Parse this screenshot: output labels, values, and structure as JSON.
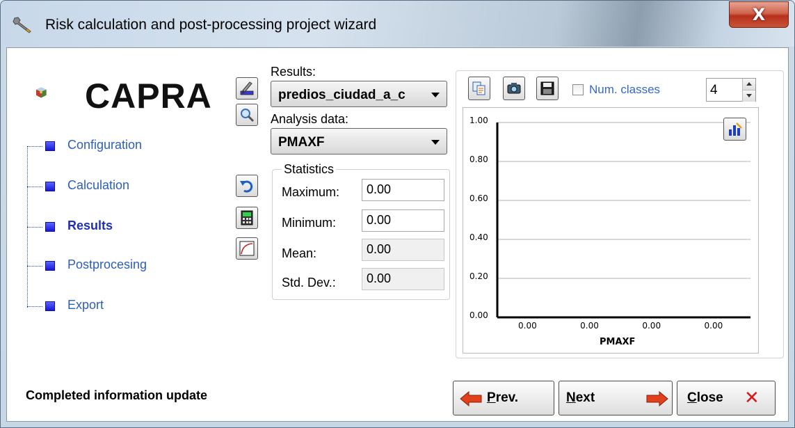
{
  "window": {
    "title": "Risk calculation and post-processing project wizard",
    "close_glyph": "X"
  },
  "logo": {
    "text": "CAPRA"
  },
  "nav": {
    "items": [
      {
        "label": "Configuration",
        "active": false
      },
      {
        "label": "Calculation",
        "active": false
      },
      {
        "label": "Results",
        "active": true
      },
      {
        "label": "Postprocesing",
        "active": false
      },
      {
        "label": "Export",
        "active": false
      }
    ]
  },
  "results": {
    "label": "Results:",
    "selected": "predios_ciudad_a_c",
    "analysis_label": "Analysis data:",
    "analysis_selected": "PMAXF"
  },
  "statistics": {
    "title": "Statistics",
    "rows": [
      {
        "label": "Maximum:",
        "value": "0.00"
      },
      {
        "label": "Minimum:",
        "value": "0.00"
      },
      {
        "label": "Mean:",
        "value": "0.00"
      },
      {
        "label": "Std. Dev.:",
        "value": "0.00"
      }
    ]
  },
  "chart_toolbar": {
    "num_classes_label": "Num. classes",
    "num_classes_value": "4"
  },
  "chart_data": {
    "type": "bar",
    "title": "",
    "xlabel": "PMAXF",
    "ylabel": "",
    "ylim": [
      0,
      1
    ],
    "y_ticks": [
      "1.00",
      "0.80",
      "0.60",
      "0.40",
      "0.20",
      "0.00"
    ],
    "categories": [
      "0.00",
      "0.00",
      "0.00",
      "0.00"
    ],
    "values": [
      0,
      0,
      0,
      0
    ],
    "grid": true
  },
  "status": {
    "text": "Completed information update"
  },
  "buttons": {
    "prev": {
      "first": "P",
      "rest": "rev."
    },
    "next": {
      "first": "N",
      "rest": "ext"
    },
    "close": {
      "first": "C",
      "rest": "lose"
    },
    "close_glyph": "✕"
  }
}
